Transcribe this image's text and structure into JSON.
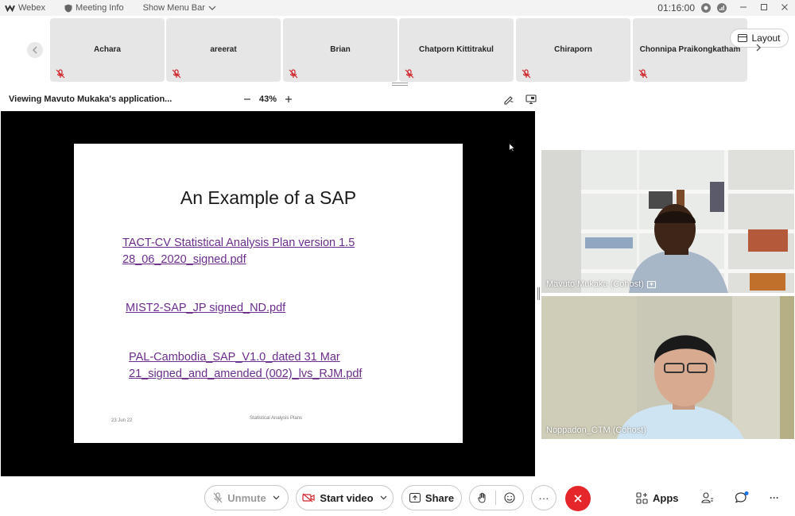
{
  "titlebar": {
    "app_name": "Webex",
    "meeting_info": "Meeting Info",
    "show_menu_bar": "Show Menu Bar",
    "clock": "01:16:00"
  },
  "participants": [
    {
      "name": "Achara"
    },
    {
      "name": "areerat"
    },
    {
      "name": "Brian"
    },
    {
      "name": "Chatporn Kittitrakul"
    },
    {
      "name": "Chiraporn"
    },
    {
      "name": "Chonnipa Praikongkatham"
    }
  ],
  "layout_button": {
    "label": "Layout"
  },
  "share_header": {
    "viewing_text": "Viewing Mavuto Mukaka's application...",
    "zoom_level": "43%"
  },
  "slide": {
    "title": "An Example of a SAP",
    "links": [
      {
        "line1": "TACT-CV Statistical Analysis Plan version 1.5",
        "line2": "28_06_2020_signed.pdf"
      },
      {
        "line1": "MIST2-SAP_JP signed_ND.pdf",
        "line2": ""
      },
      {
        "line1": "PAL-Cambodia_SAP_V1.0_dated 31 Mar",
        "line2": "21_signed_and_amended (002)_lvs_RJM.pdf"
      }
    ],
    "footer_date": "23 Jun 22",
    "footer_center": "Statistical Analysis Plans"
  },
  "videos": [
    {
      "label": "Mavuto Mukaka (Cohost)"
    },
    {
      "label": "Noppadon_CTM (Cohost)"
    }
  ],
  "controls": {
    "unmute": "Unmute",
    "start_video": "Start video",
    "share": "Share",
    "apps": "Apps",
    "more_glyph": "···"
  },
  "colors": {
    "link_purple": "#6a2d8c",
    "end_call_red": "#e5272b",
    "mute_red": "#d0242a",
    "notification_blue": "#1a73e8"
  }
}
